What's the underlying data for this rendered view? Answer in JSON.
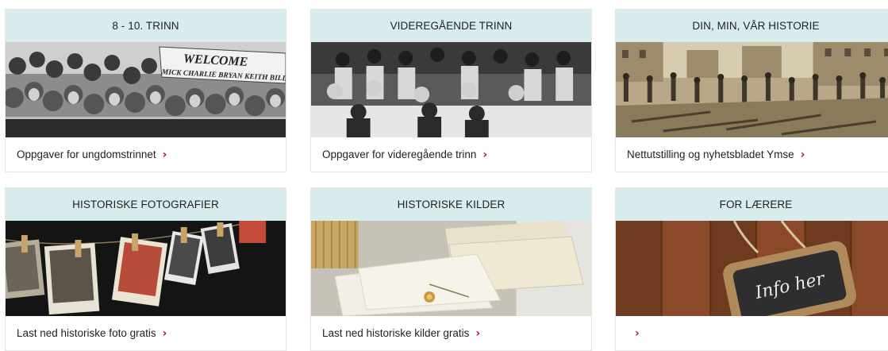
{
  "cards": [
    {
      "title": "8 - 10. TRINN",
      "link": "Oppgaver for ungdomstrinnet",
      "chevron": "›",
      "image_icon": "crowd-photo",
      "banner_text_1": "WELCOME",
      "banner_text_2": "MICK CHARLIE BRYAN KEITH BILL"
    },
    {
      "title": "VIDEREGÅENDE TRINN",
      "link": "Oppgaver for videregående trinn",
      "chevron": "›",
      "image_icon": "class-photo"
    },
    {
      "title": "DIN, MIN, VÅR HISTORIE",
      "link": "Nettutstilling og nyhetsbladet Ymse",
      "chevron": "›",
      "image_icon": "street-photo"
    },
    {
      "title": "HISTORISKE FOTOGRAFIER",
      "link": "Last ned historiske foto gratis",
      "chevron": "›",
      "image_icon": "hanging-photos"
    },
    {
      "title": "HISTORISKE KILDER",
      "link": "Last ned historiske kilder gratis",
      "chevron": "›",
      "image_icon": "documents-photo"
    },
    {
      "title": "FOR LÆRERE",
      "link": "",
      "chevron": "›",
      "image_icon": "chalkboard-sign",
      "sign_text": "Info her"
    }
  ],
  "colors": {
    "header_bg": "#d8ecee",
    "chevron": "#b3121e",
    "text": "#222222"
  }
}
